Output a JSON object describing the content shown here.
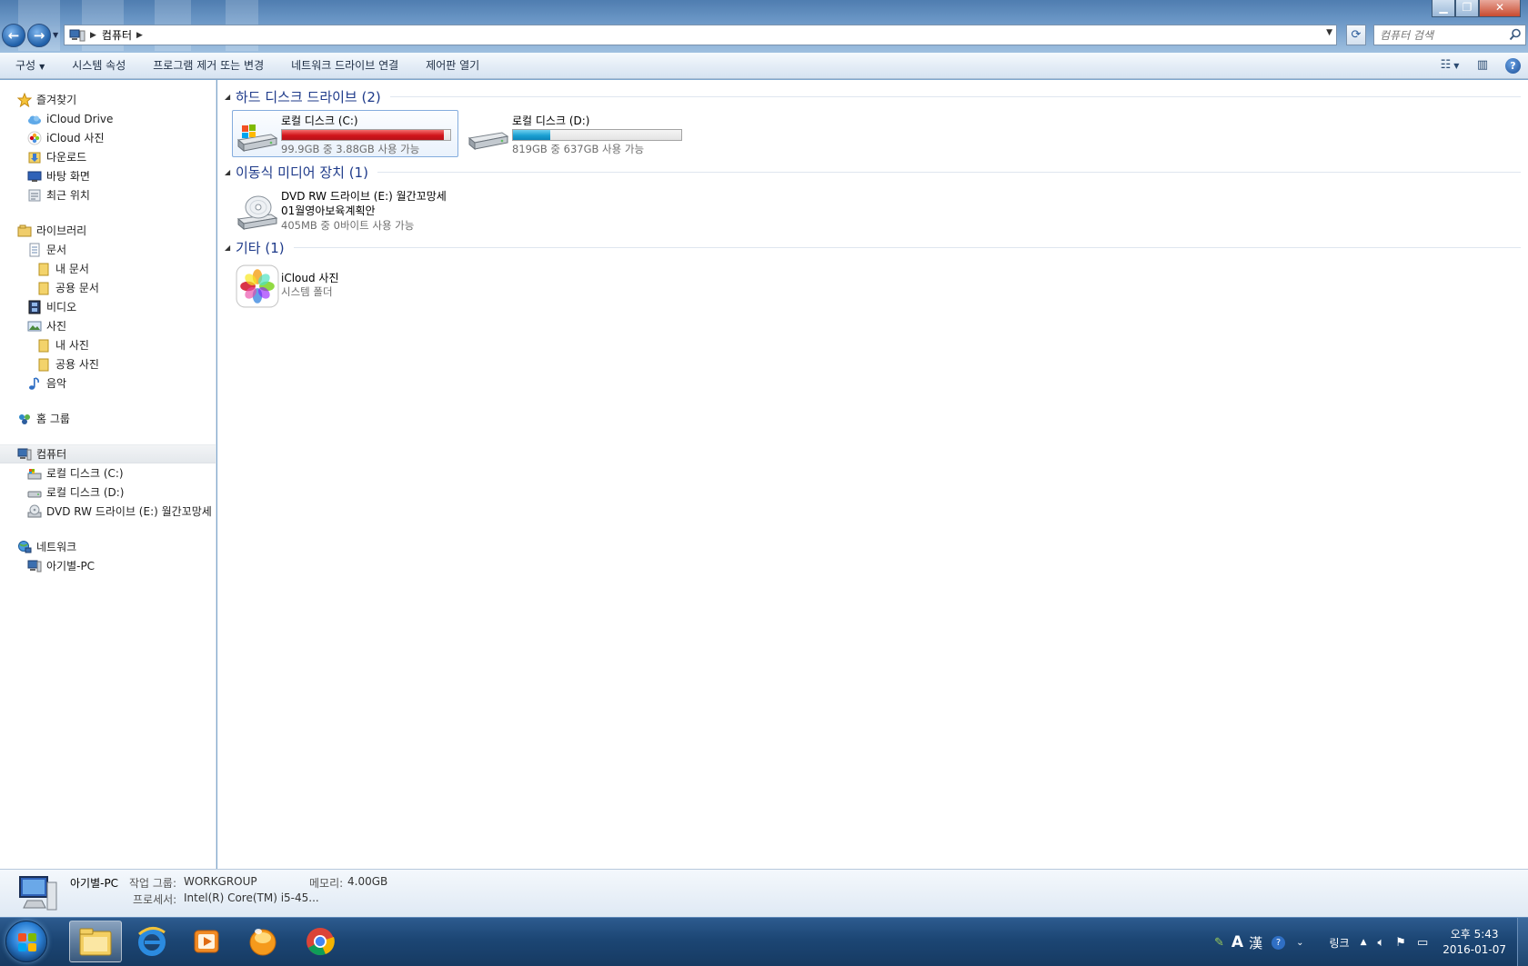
{
  "window": {
    "address": {
      "location": "컴퓨터"
    },
    "search": {
      "placeholder": "컴퓨터 검색"
    }
  },
  "commandbar": {
    "items": [
      {
        "label": "구성",
        "has_dropdown": true
      },
      {
        "label": "시스템 속성"
      },
      {
        "label": "프로그램 제거 또는 변경"
      },
      {
        "label": "네트워크 드라이브 연결"
      },
      {
        "label": "제어판 열기"
      }
    ]
  },
  "navpane": {
    "favorites": {
      "label": "즐겨찾기",
      "items": [
        "iCloud Drive",
        "iCloud 사진",
        "다운로드",
        "바탕 화면",
        "최근 위치"
      ]
    },
    "libraries": {
      "label": "라이브러리",
      "documents": "문서",
      "my_documents": "내 문서",
      "public_documents": "공용 문서",
      "videos": "비디오",
      "pictures": "사진",
      "my_pictures": "내 사진",
      "public_pictures": "공용 사진",
      "music": "음악"
    },
    "homegroup": {
      "label": "홈 그룹"
    },
    "computer": {
      "label": "컴퓨터",
      "items": [
        "로컬 디스크 (C:)",
        "로컬 디스크 (D:)",
        "DVD RW 드라이브 (E:) 월간꼬망세"
      ]
    },
    "network": {
      "label": "네트워크",
      "items": [
        "아기별-PC"
      ]
    }
  },
  "content": {
    "groups": {
      "hdd": {
        "title": "하드 디스크 드라이브 (2)"
      },
      "removable": {
        "title": "이동식 미디어 장치 (1)"
      },
      "other": {
        "title": "기타 (1)"
      }
    },
    "drives": {
      "c": {
        "name": "로컬 디스크 (C:)",
        "info": "99.9GB 중 3.88GB 사용 가능",
        "used_fraction": 0.96
      },
      "d": {
        "name": "로컬 디스크 (D:)",
        "info": "819GB 중 637GB 사용 가능",
        "used_fraction": 0.22
      },
      "e": {
        "name": "DVD RW 드라이브 (E:) 월간꼬망세",
        "name2": "01월영아보육계획안",
        "info": "405MB 중 0바이트 사용 가능"
      },
      "icloud": {
        "name": "iCloud 사진",
        "info": "시스템 폴더"
      }
    }
  },
  "details": {
    "pc_name": "아기별-PC",
    "workgroup_label": "작업 그룹:",
    "workgroup_value": "WORKGROUP",
    "memory_label": "메모리:",
    "memory_value": "4.00GB",
    "processor_label": "프로세서:",
    "processor_value": "Intel(R) Core(TM) i5-45..."
  },
  "taskbar": {
    "tray": {
      "ime_a": "A",
      "ime_han": "漢",
      "links_label": "링크"
    },
    "clock": {
      "time": "오후 5:43",
      "date": "2016-01-07"
    }
  },
  "colors": {
    "disk_full": "#d1141a",
    "disk_normal": "#1ba0d2",
    "group_title": "#1e3a8a"
  }
}
